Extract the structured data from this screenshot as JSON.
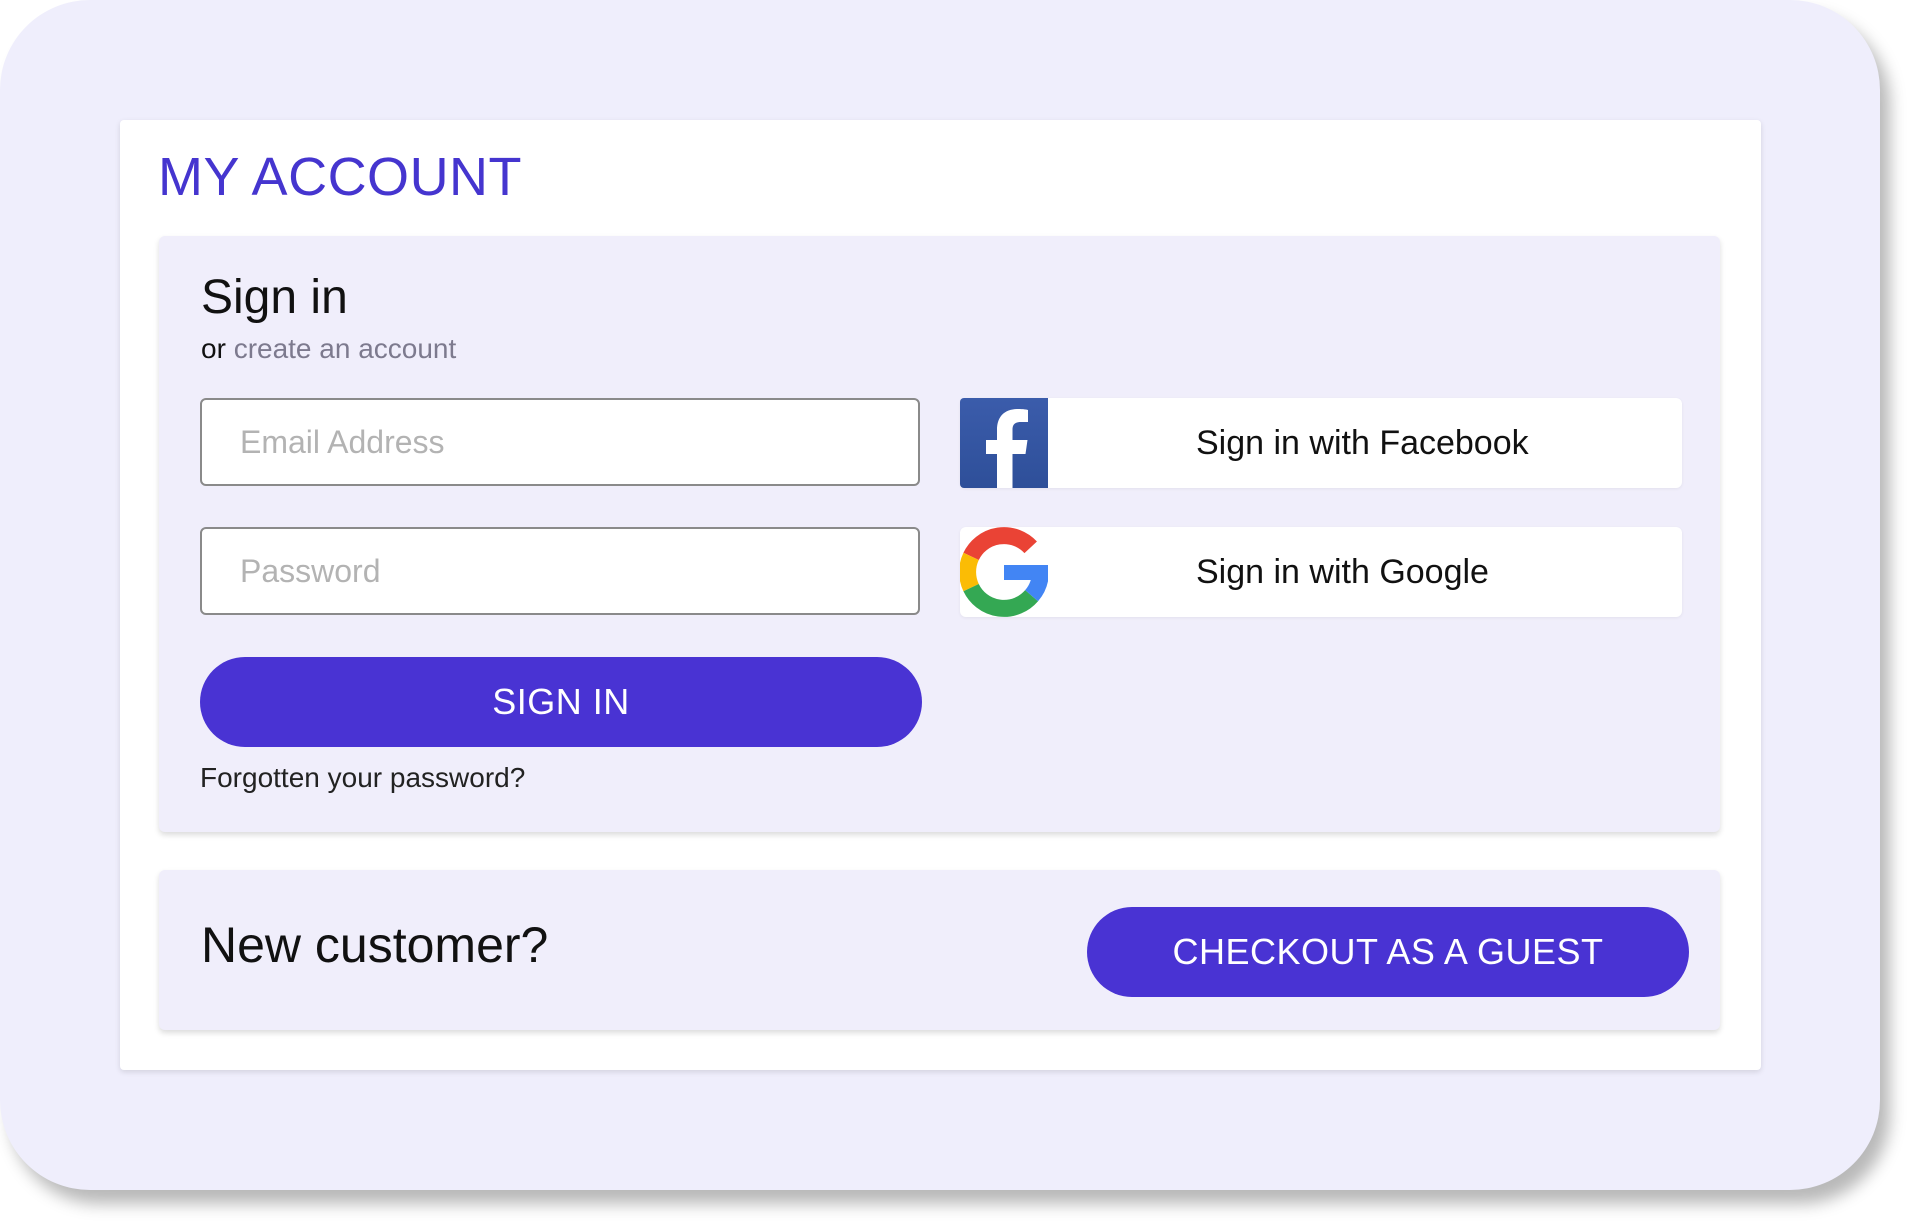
{
  "page": {
    "title": "MY ACCOUNT"
  },
  "signin": {
    "title": "Sign in",
    "or_text": "or",
    "create_account_link": "create an account",
    "email_placeholder": "Email Address",
    "email_value": "",
    "password_placeholder": "Password",
    "password_value": "",
    "submit_label": "SIGN IN",
    "forgot_password_link": "Forgotten your password?"
  },
  "social": {
    "facebook": {
      "label": "Sign in with Facebook",
      "icon": "facebook-icon",
      "color": "#3b5cab"
    },
    "google": {
      "label": "Sign in with Google",
      "icon": "google-icon"
    }
  },
  "guest": {
    "heading": "New customer?",
    "button_label": "CHECKOUT AS A GUEST"
  },
  "colors": {
    "accent": "#4933d3",
    "title": "#4535cf",
    "background": "#efeefc",
    "panel": "#f0eefb"
  }
}
